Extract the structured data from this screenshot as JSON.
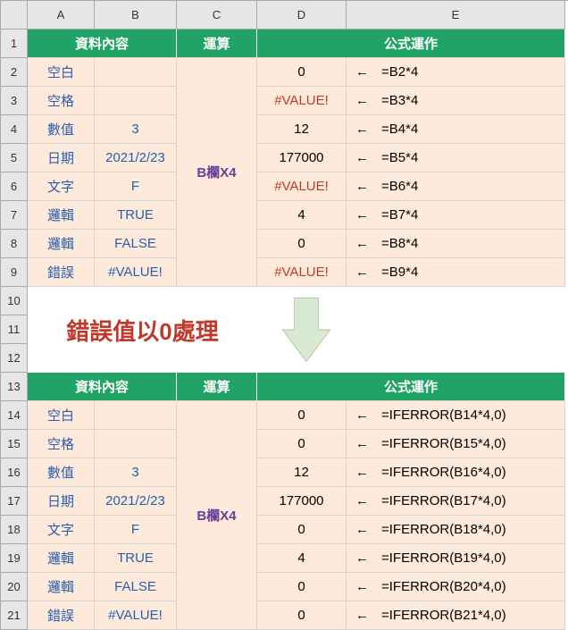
{
  "columns": [
    "A",
    "B",
    "C",
    "D",
    "E"
  ],
  "row_numbers": [
    1,
    2,
    3,
    4,
    5,
    6,
    7,
    8,
    9,
    10,
    11,
    12,
    13,
    14,
    15,
    16,
    17,
    18,
    19,
    20,
    21
  ],
  "headers": {
    "data_content": "資料內容",
    "operation": "運算",
    "formula_work": "公式運作"
  },
  "op_label": "B欄X4",
  "arrow_left": "←",
  "message": "錯誤值以0處理",
  "top_rows": [
    {
      "a": "空白",
      "b": "",
      "d": "0",
      "d_err": false,
      "e": "=B2*4"
    },
    {
      "a": "空格",
      "b": "",
      "d": "#VALUE!",
      "d_err": true,
      "e": "=B3*4"
    },
    {
      "a": "數值",
      "b": "3",
      "d": "12",
      "d_err": false,
      "e": "=B4*4"
    },
    {
      "a": "日期",
      "b": "2021/2/23",
      "d": "177000",
      "d_err": false,
      "e": "=B5*4"
    },
    {
      "a": "文字",
      "b": "F",
      "d": "#VALUE!",
      "d_err": true,
      "e": "=B6*4"
    },
    {
      "a": "邏輯",
      "b": "TRUE",
      "d": "4",
      "d_err": false,
      "e": "=B7*4"
    },
    {
      "a": "邏輯",
      "b": "FALSE",
      "d": "0",
      "d_err": false,
      "e": "=B8*4"
    },
    {
      "a": "錯誤",
      "b": "#VALUE!",
      "d": "#VALUE!",
      "d_err": true,
      "e": "=B9*4"
    }
  ],
  "bottom_rows": [
    {
      "a": "空白",
      "b": "",
      "d": "0",
      "e": "=IFERROR(B14*4,0)"
    },
    {
      "a": "空格",
      "b": "",
      "d": "0",
      "e": "=IFERROR(B15*4,0)"
    },
    {
      "a": "數值",
      "b": "3",
      "d": "12",
      "e": "=IFERROR(B16*4,0)"
    },
    {
      "a": "日期",
      "b": "2021/2/23",
      "d": "177000",
      "e": "=IFERROR(B17*4,0)"
    },
    {
      "a": "文字",
      "b": "F",
      "d": "0",
      "e": "=IFERROR(B18*4,0)"
    },
    {
      "a": "邏輯",
      "b": "TRUE",
      "d": "4",
      "e": "=IFERROR(B19*4,0)"
    },
    {
      "a": "邏輯",
      "b": "FALSE",
      "d": "0",
      "e": "=IFERROR(B20*4,0)"
    },
    {
      "a": "錯誤",
      "b": "#VALUE!",
      "d": "0",
      "e": "=IFERROR(B21*4,0)"
    }
  ]
}
